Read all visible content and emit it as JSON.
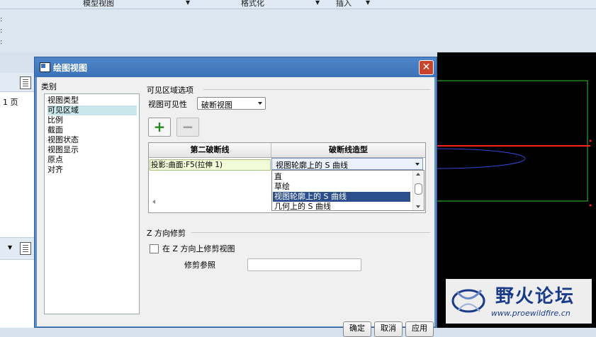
{
  "menubar": {
    "items": [
      "模型视图",
      "格式化",
      "插入"
    ]
  },
  "left_panel": {
    "page_label": "1 页"
  },
  "dialog": {
    "title": "绘图视图",
    "close": "✕",
    "category_label": "类别",
    "categories": [
      "视图类型",
      "可见区域",
      "比例",
      "截面",
      "视图状态",
      "视图显示",
      "原点",
      "对齐"
    ],
    "selected_category": "可见区域",
    "visible_area": {
      "group_title": "可见区域选项",
      "visibility_label": "视图可见性",
      "visibility_value": "破断视图",
      "add_symbol": "+",
      "remove_symbol": "−",
      "table": {
        "headers": [
          "第二破断线",
          "破断线造型"
        ],
        "rows": [
          {
            "line": "投影:曲面:F5(拉伸 1)",
            "style": "视图轮廓上的 S 曲线"
          }
        ],
        "style_options": [
          "直",
          "草绘",
          "视图轮廓上的 S 曲线",
          "几何上的 S 曲线"
        ],
        "selected_option": "视图轮廓上的 S 曲线"
      }
    },
    "z_clip": {
      "group_title": "Z 方向修剪",
      "checkbox_label": "在 Z 方向上修剪视图",
      "checked": false,
      "trim_ref_label": "修剪参照",
      "trim_ref_value": ""
    },
    "buttons": {
      "ok": "确定",
      "cancel": "取消",
      "apply": "应用"
    }
  },
  "watermark": {
    "title": "野火论坛",
    "url": "www.proewildfire.cn"
  },
  "colors": {
    "dialog_frame": "#3c73b8",
    "selection": "#2d4e8c",
    "category_highlight": "#c9e6ea",
    "add_icon": "#1f8a1f"
  }
}
